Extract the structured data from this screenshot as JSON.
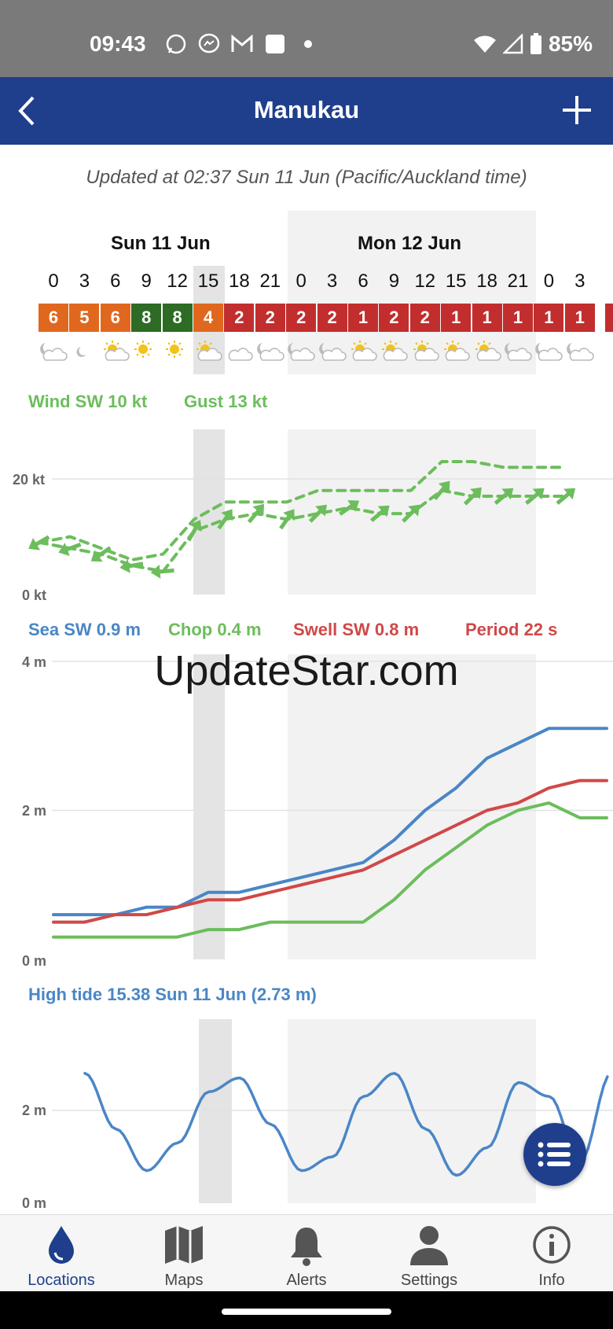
{
  "status": {
    "time": "09:43",
    "battery": "85%",
    "icons": [
      "whatsapp-icon",
      "messenger-icon",
      "gmail-icon",
      "app-icon",
      "dot-icon"
    ]
  },
  "appbar": {
    "title": "Manukau"
  },
  "updated": "Updated at 02:37 Sun 11 Jun (Pacific/Auckland time)",
  "days": [
    "Sun 11 Jun",
    "Mon 12 Jun"
  ],
  "hours": [
    "0",
    "3",
    "6",
    "9",
    "12",
    "15",
    "18",
    "21",
    "0",
    "3",
    "6",
    "9",
    "12",
    "15",
    "18",
    "21",
    "0",
    "3"
  ],
  "ratings": [
    {
      "v": "6",
      "c": "#e0681e"
    },
    {
      "v": "5",
      "c": "#e0681e"
    },
    {
      "v": "6",
      "c": "#e0681e"
    },
    {
      "v": "8",
      "c": "#2e6b25"
    },
    {
      "v": "8",
      "c": "#2e6b25"
    },
    {
      "v": "4",
      "c": "#e0681e"
    },
    {
      "v": "2",
      "c": "#c22e2e"
    },
    {
      "v": "2",
      "c": "#c22e2e"
    },
    {
      "v": "2",
      "c": "#c22e2e"
    },
    {
      "v": "2",
      "c": "#c22e2e"
    },
    {
      "v": "1",
      "c": "#c22e2e"
    },
    {
      "v": "2",
      "c": "#c22e2e"
    },
    {
      "v": "2",
      "c": "#c22e2e"
    },
    {
      "v": "1",
      "c": "#c22e2e"
    },
    {
      "v": "1",
      "c": "#c22e2e"
    },
    {
      "v": "1",
      "c": "#c22e2e"
    },
    {
      "v": "1",
      "c": "#c22e2e"
    },
    {
      "v": "1",
      "c": "#c22e2e"
    }
  ],
  "weather_icons": [
    "moon-cloud-icon",
    "moon-icon",
    "sun-cloud-icon",
    "sun-icon",
    "sun-icon",
    "sun-cloud-icon",
    "cloud-icon",
    "moon-cloud-icon",
    "moon-cloud-icon",
    "moon-cloud-icon",
    "sun-cloud-icon",
    "sun-cloud-icon",
    "sun-cloud-icon",
    "sun-cloud-icon",
    "sun-cloud-icon",
    "moon-cloud-icon",
    "moon-cloud-icon",
    "moon-cloud-icon"
  ],
  "wind": {
    "label_wind": "Wind SW 10 kt",
    "label_gust": "Gust 13 kt",
    "axis": [
      "20 kt",
      "0 kt"
    ],
    "color": "#6cbd5c"
  },
  "waves": {
    "label_sea": "Sea SW 0.9 m",
    "label_chop": "Chop 0.4 m",
    "label_swell": "Swell SW 0.8 m",
    "label_period": "Period 22 s",
    "axis": [
      "4 m",
      "2 m",
      "0 m"
    ],
    "colors": {
      "sea": "#4a86c6",
      "chop": "#6cbd5c",
      "swell": "#d04848"
    }
  },
  "watermark": "UpdateStar.com",
  "tide": {
    "label": "High tide 15.38 Sun 11 Jun (2.73 m)",
    "axis": [
      "2 m",
      "0 m"
    ],
    "color": "#4a86c6"
  },
  "chart_data": [
    {
      "type": "line",
      "x": [
        "Sun 0",
        "3",
        "6",
        "9",
        "12",
        "15",
        "18",
        "21",
        "Mon 0",
        "3",
        "6",
        "9",
        "12",
        "15",
        "18",
        "21",
        "Tue 0",
        "3"
      ],
      "series": [
        {
          "name": "Wind",
          "values": [
            9,
            8,
            7,
            5,
            4,
            11,
            13,
            14,
            13,
            14,
            15,
            14,
            14,
            18,
            17,
            17,
            17,
            17
          ]
        },
        {
          "name": "Gust",
          "values": [
            9,
            10,
            8,
            6,
            7,
            13,
            16,
            16,
            16,
            18,
            18,
            18,
            18,
            23,
            23,
            22,
            22,
            22
          ]
        }
      ],
      "ylim": [
        0,
        25
      ]
    },
    {
      "type": "line",
      "x": [
        "Sun 0",
        "3",
        "6",
        "9",
        "12",
        "15",
        "18",
        "21",
        "Mon 0",
        "3",
        "6",
        "9",
        "12",
        "15",
        "18",
        "21",
        "Tue 0",
        "3"
      ],
      "series": [
        {
          "name": "Sea",
          "values": [
            0.6,
            0.6,
            0.6,
            0.7,
            0.7,
            0.9,
            0.9,
            1.0,
            1.1,
            1.2,
            1.3,
            1.6,
            2.0,
            2.3,
            2.7,
            2.9,
            3.1,
            3.1
          ]
        },
        {
          "name": "Swell",
          "values": [
            0.5,
            0.5,
            0.6,
            0.6,
            0.7,
            0.8,
            0.8,
            0.9,
            1.0,
            1.1,
            1.2,
            1.4,
            1.6,
            1.8,
            2.0,
            2.1,
            2.3,
            2.4
          ]
        },
        {
          "name": "Chop",
          "values": [
            0.3,
            0.3,
            0.3,
            0.3,
            0.3,
            0.4,
            0.4,
            0.5,
            0.5,
            0.5,
            0.5,
            0.8,
            1.2,
            1.5,
            1.8,
            2.0,
            2.1,
            1.9
          ]
        }
      ],
      "ylim": [
        0,
        4
      ]
    },
    {
      "type": "line",
      "x": [
        "Sun 0",
        "3",
        "6",
        "9",
        "12",
        "15",
        "18",
        "21",
        "Mon 0",
        "3",
        "6",
        "9",
        "12",
        "15",
        "18",
        "21",
        "Tue 0",
        "3"
      ],
      "series": [
        {
          "name": "Tide",
          "values": [
            2.8,
            1.6,
            0.7,
            1.3,
            2.4,
            2.7,
            1.7,
            0.7,
            1.0,
            2.3,
            2.8,
            1.6,
            0.6,
            1.2,
            2.6,
            2.3,
            0.9,
            2.8
          ]
        }
      ],
      "ylim": [
        0,
        3.5
      ]
    }
  ],
  "fab_icon": "list-icon",
  "nav": [
    {
      "label": "Locations",
      "icon": "drop-icon"
    },
    {
      "label": "Maps",
      "icon": "map-icon"
    },
    {
      "label": "Alerts",
      "icon": "bell-icon"
    },
    {
      "label": "Settings",
      "icon": "person-icon"
    },
    {
      "label": "Info",
      "icon": "info-icon"
    }
  ]
}
